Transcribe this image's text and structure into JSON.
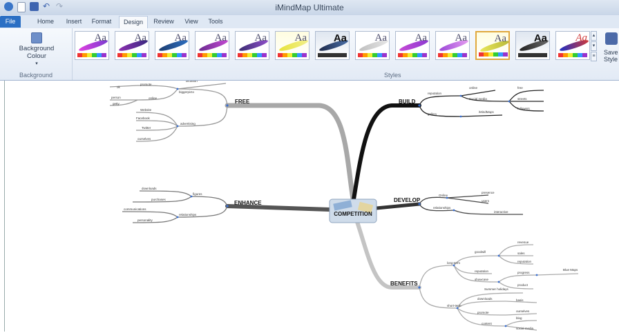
{
  "app": {
    "title": "iMindMap Ultimate"
  },
  "tabs": [
    {
      "label": "File"
    },
    {
      "label": "Home"
    },
    {
      "label": "Insert"
    },
    {
      "label": "Format"
    },
    {
      "label": "Design"
    },
    {
      "label": "Review"
    },
    {
      "label": "View"
    },
    {
      "label": "Tools"
    }
  ],
  "ribbon": {
    "background_button": "Background Colour",
    "background_group": "Background",
    "styles_group": "Styles",
    "save_style": "Save Style",
    "style_tile_text": "Aa",
    "selected_style_index": 10
  },
  "mindmap": {
    "central": "COMPETITION",
    "branches": {
      "free": {
        "label": "FREE",
        "sub": [
          "biggerpicto",
          "advertising"
        ],
        "leaves": [
          "dictation",
          "promote",
          "ok",
          "online",
          "person",
          "getty",
          "Website",
          "Facebook",
          "Twitter",
          "ourselves"
        ]
      },
      "enhance": {
        "label": "ENHANCE",
        "sub": [
          "figures",
          "relationships"
        ],
        "leaves": [
          "downloads",
          "purchases",
          "communications",
          "personality"
        ]
      },
      "build": {
        "label": "BUILD",
        "sub": [
          "reputation",
          "gallery"
        ],
        "leaves": [
          "online",
          "Social media",
          "free",
          "streets",
          "followers",
          "iMindMaps"
        ]
      },
      "develop": {
        "label": "DEVELOP",
        "sub": [
          "Online",
          "relationships"
        ],
        "leaves": [
          "presence",
          "users",
          "interactive"
        ]
      },
      "benefits": {
        "label": "BENEFITS",
        "sub": [
          "long-term",
          "short-term"
        ],
        "leaves": [
          "goodwill",
          "revenue",
          "sales",
          "reputation",
          "reputation",
          "showcase",
          "progress",
          "product",
          "Blue Maps",
          "Summer holidays",
          "downloads",
          "basis",
          "promote",
          "ourselves",
          "blog",
          "content",
          "social media"
        ]
      }
    }
  },
  "colors": {
    "tab_file": "#2b6fc4",
    "selected_style_border": "#e0a83d",
    "branch_free": "#a8a8a8",
    "branch_enhance": "#555555",
    "branch_build": "#111111",
    "branch_develop": "#333333",
    "branch_benefits": "#c4c4c4"
  }
}
